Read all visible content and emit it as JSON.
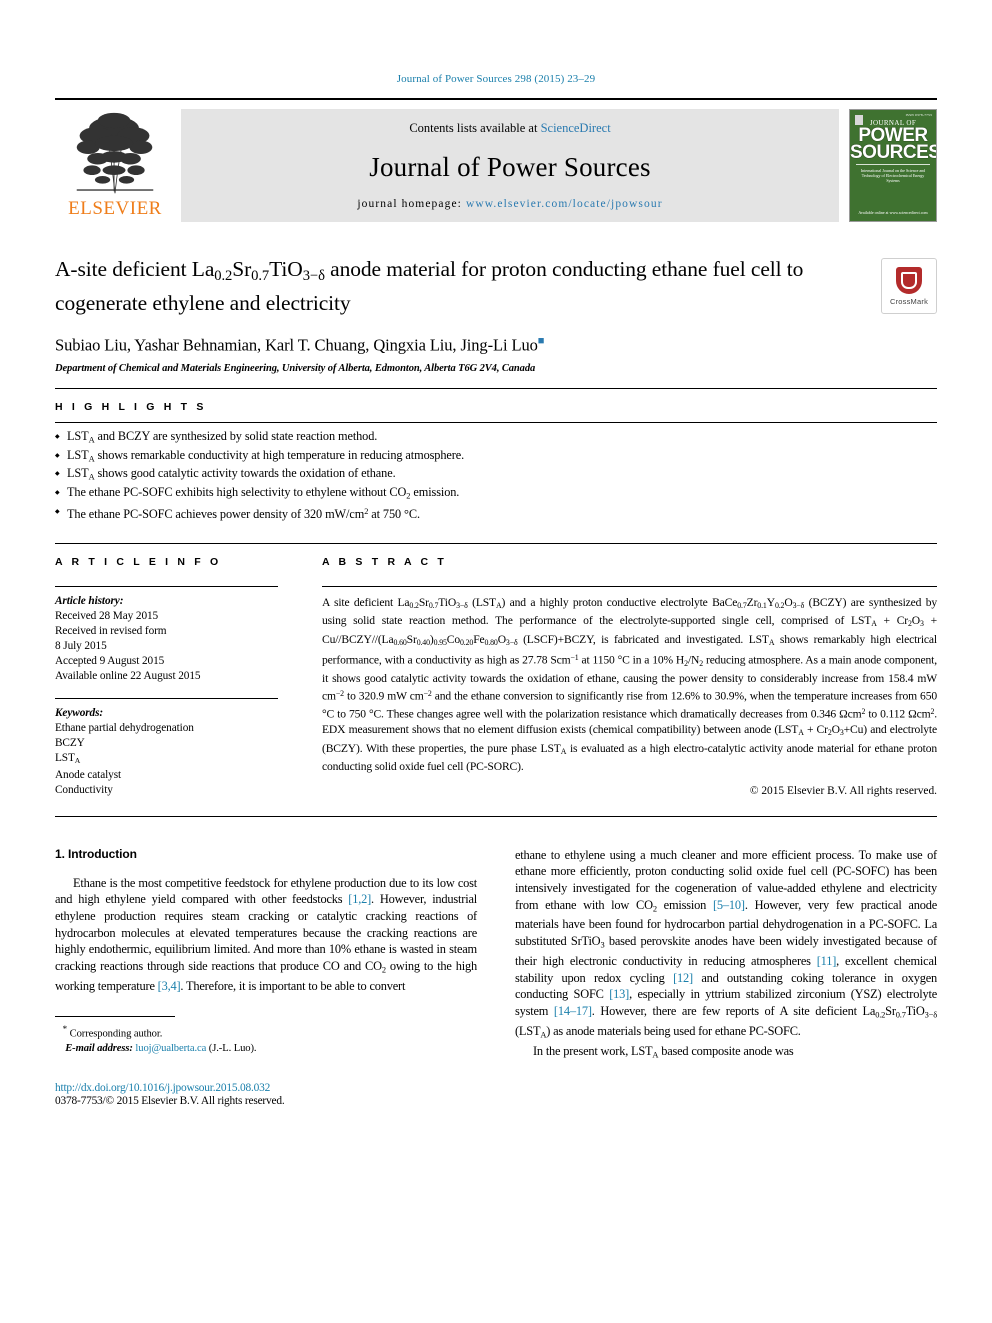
{
  "running_head": "Journal of Power Sources 298 (2015) 23–29",
  "masthead": {
    "publisher": "ELSEVIER",
    "contents_prefix": "Contents lists available at ",
    "contents_link": "ScienceDirect",
    "journal_name": "Journal of Power Sources",
    "homepage_prefix": "journal homepage: ",
    "homepage_url": "www.elsevier.com/locate/jpowsour",
    "cover": {
      "top_note": "ISSN 0378-7753",
      "line1": "JOURNAL OF",
      "line2": "POWER",
      "line3": "SOURCES",
      "blurb": "International Journal on the Science and Technology of Electrochemical Energy Systems",
      "bottom": "Available online at\nwww.sciencedirect.com"
    }
  },
  "article": {
    "title": "A-site deficient La0.2Sr0.7TiO3−δ anode material for proton conducting ethane fuel cell to cogenerate ethylene and electricity",
    "authors": "Subiao Liu, Yashar Behnamian, Karl T. Chuang, Qingxia Liu, Jing-Li Luo",
    "affiliation": "Department of Chemical and Materials Engineering, University of Alberta, Edmonton, Alberta T6G 2V4, Canada",
    "crossmark_label": "CrossMark"
  },
  "highlights": {
    "heading": "H I G H L I G H T S",
    "items": [
      "LSTA and BCZY are synthesized by solid state reaction method.",
      "LSTA shows remarkable conductivity at high temperature in reducing atmosphere.",
      "LSTA shows good catalytic activity towards the oxidation of ethane.",
      "The ethane PC-SOFC exhibits high selectivity to ethylene without CO2 emission.",
      "The ethane PC-SOFC achieves power density of 320 mW/cm2 at 750 °C."
    ]
  },
  "article_info": {
    "heading": "A R T I C L E   I N F O",
    "history_label": "Article history:",
    "history": [
      "Received 28 May 2015",
      "Received in revised form",
      "8 July 2015",
      "Accepted 9 August 2015",
      "Available online 22 August 2015"
    ],
    "keywords_label": "Keywords:",
    "keywords": [
      "Ethane partial dehydrogenation",
      "BCZY",
      "LSTA",
      "Anode catalyst",
      "Conductivity"
    ]
  },
  "abstract": {
    "heading": "A B S T R A C T",
    "text": "A site deficient La0.2Sr0.7TiO3−δ (LSTA) and a highly proton conductive electrolyte BaCe0.7Zr0.1Y0.2O3−δ (BCZY) are synthesized by using solid state reaction method. The performance of the electrolyte-supported single cell, comprised of LSTA + Cr2O3 + Cu//BCZY//(La0.60Sr0.40)0.95Co0.20Fe0.80O3−δ (LSCF)+BCZY, is fabricated and investigated. LSTA shows remarkably high electrical performance, with a conductivity as high as 27.78 Scm−1 at 1150 °C in a 10% H2/N2 reducing atmosphere. As a main anode component, it shows good catalytic activity towards the oxidation of ethane, causing the power density to considerably increase from 158.4 mW cm−2 to 320.9 mW cm−2 and the ethane conversion to significantly rise from 12.6% to 30.9%, when the temperature increases from 650 °C to 750 °C. These changes agree well with the polarization resistance which dramatically decreases from 0.346 Ωcm2 to 0.112 Ωcm2. EDX measurement shows that no element diffusion exists (chemical compatibility) between anode (LSTA + Cr2O3+Cu) and electrolyte (BCZY). With these properties, the pure phase LSTA is evaluated as a high electro-catalytic activity anode material for ethane proton conducting solid oxide fuel cell (PC-SORC).",
    "copyright": "© 2015 Elsevier B.V. All rights reserved."
  },
  "introduction": {
    "heading": "1.  Introduction",
    "left_paragraph": "Ethane is the most competitive feedstock for ethylene production due to its low cost and high ethylene yield compared with other feedstocks [1,2]. However, industrial ethylene production requires steam cracking or catalytic cracking reactions of hydrocarbon molecules at elevated temperatures because the cracking reactions are highly endothermic, equilibrium limited. And more than 10% ethane is wasted in steam cracking reactions through side reactions that produce CO and CO2 owing to the high working temperature [3,4]. Therefore, it is important to be able to convert",
    "right_paragraph": "ethane to ethylene using a much cleaner and more efficient process. To make use of ethane more efficiently, proton conducting solid oxide fuel cell (PC-SOFC) has been intensively investigated for the cogeneration of value-added ethylene and electricity from ethane with low CO2 emission [5–10]. However, very few practical anode materials have been found for hydrocarbon partial dehydrogenation in a PC-SOFC. La substituted SrTiO3 based perovskite anodes have been widely investigated because of their high electronic conductivity in reducing atmospheres [11], excellent chemical stability upon redox cycling [12] and outstanding coking tolerance in oxygen conducting SOFC [13], especially in yttrium stabilized zirconium (YSZ) electrolyte system [14–17]. However, there are few reports of A site deficient La0.2Sr0.7TiO3−δ (LSTA) as anode materials being used for ethane PC-SOFC.",
    "right_paragraph2": "In the present work, LSTA based composite anode was"
  },
  "footer": {
    "corresponding_star": "*",
    "corresponding_label": "Corresponding author.",
    "email_label": "E-mail address:",
    "email": "luoj@ualberta.ca",
    "email_person": "(J.-L. Luo).",
    "doi": "http://dx.doi.org/10.1016/j.jpowsour.2015.08.032",
    "issn": "0378-7753/© 2015 Elsevier B.V. All rights reserved."
  },
  "colors": {
    "link": "#1a7fab",
    "elsevier_orange": "#ef7d1a",
    "cover_green": "#3f7230",
    "crossmark_red": "#b32b2b"
  }
}
